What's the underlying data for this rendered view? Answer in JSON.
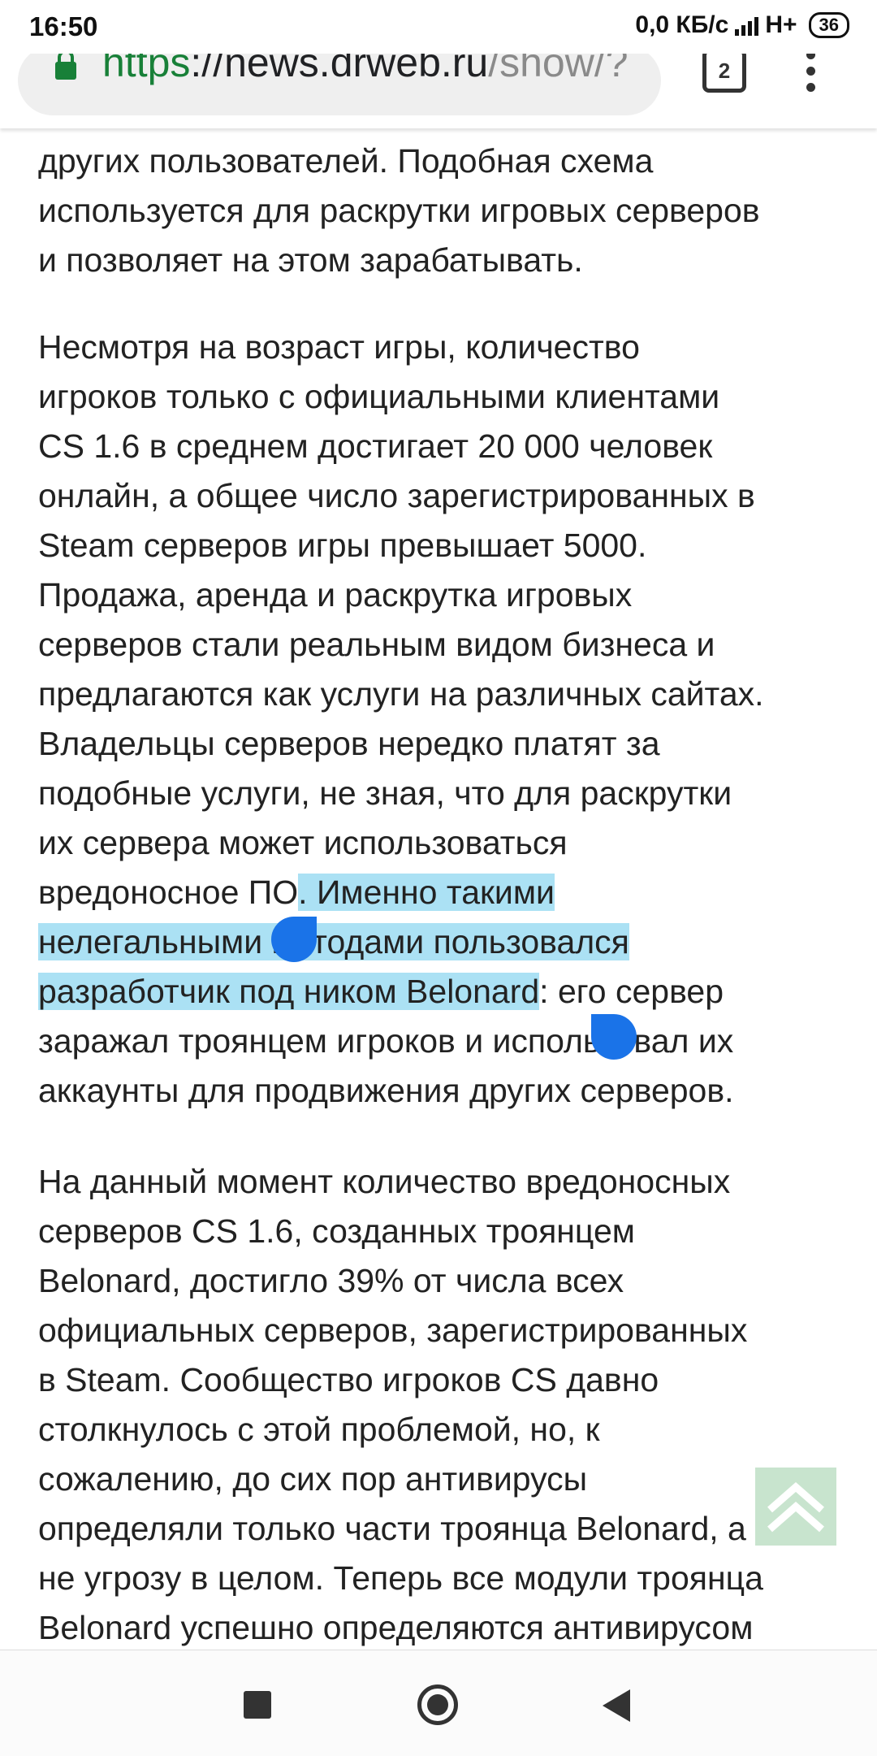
{
  "status_bar": {
    "time": "16:50",
    "speed": "0,0 КБ/с",
    "network": "H+",
    "battery": "36"
  },
  "toolbar": {
    "url_scheme": "https",
    "url_host": "://news.drweb.ru",
    "url_path": "/show/?",
    "tab_count": "2"
  },
  "article": {
    "p1": "других пользователей. Подобная схема\nиспользуется для раскрутки игровых серверов\nи позволяет на этом зарабатывать.",
    "p2_before": "Несмотря на возраст игры, количество\nигроков только с официальными клиентами\nCS 1.6 в среднем достигает 20 000 человек\nонлайн, а общее число зарегистрированных в\nSteam серверов игры превышает 5000.\nПродажа, аренда и раскрутка игровых\nсерверов стали реальным видом бизнеса и\nпредлагаются как услуги на различных сайтах.\nВладельцы серверов нередко платят за\nподобные услуги, не зная, что для раскрутки\nих сервера может использоваться\nвредоносное ПО",
    "p2_selected": ". Именно такими\nнелегальными методами пользовался\nразработчик под ником Belonard",
    "p2_after": ": его сервер\nзаражал троянцем игроков и использовал их\nаккаунты для продвижения других серверов.",
    "p3": "На данный момент количество вредоносных\nсерверов CS 1.6, созданных троянцем\nBelonard, достигло 39% от числа всех\nофициальных серверов, зарегистрированных\nв Steam. Сообщество игроков CS давно\nстолкнулось с этой проблемой, но, к\nсожалению, до сих пор антивирусы\nопределяли только части троянца Belonard, а\nне угрозу в целом. Теперь все модули троянца\nBelonard успешно определяются антивирусом"
  },
  "colors": {
    "selection": "#abe1f4",
    "handle": "#1a73e8",
    "scheme_green": "#188038"
  },
  "icons": {
    "lock": "lock-icon",
    "menu": "more-vert-icon",
    "scroll_top": "double-chevron-up-icon",
    "nav_recent": "square-icon",
    "nav_home": "circle-icon",
    "nav_back": "triangle-back-icon"
  }
}
